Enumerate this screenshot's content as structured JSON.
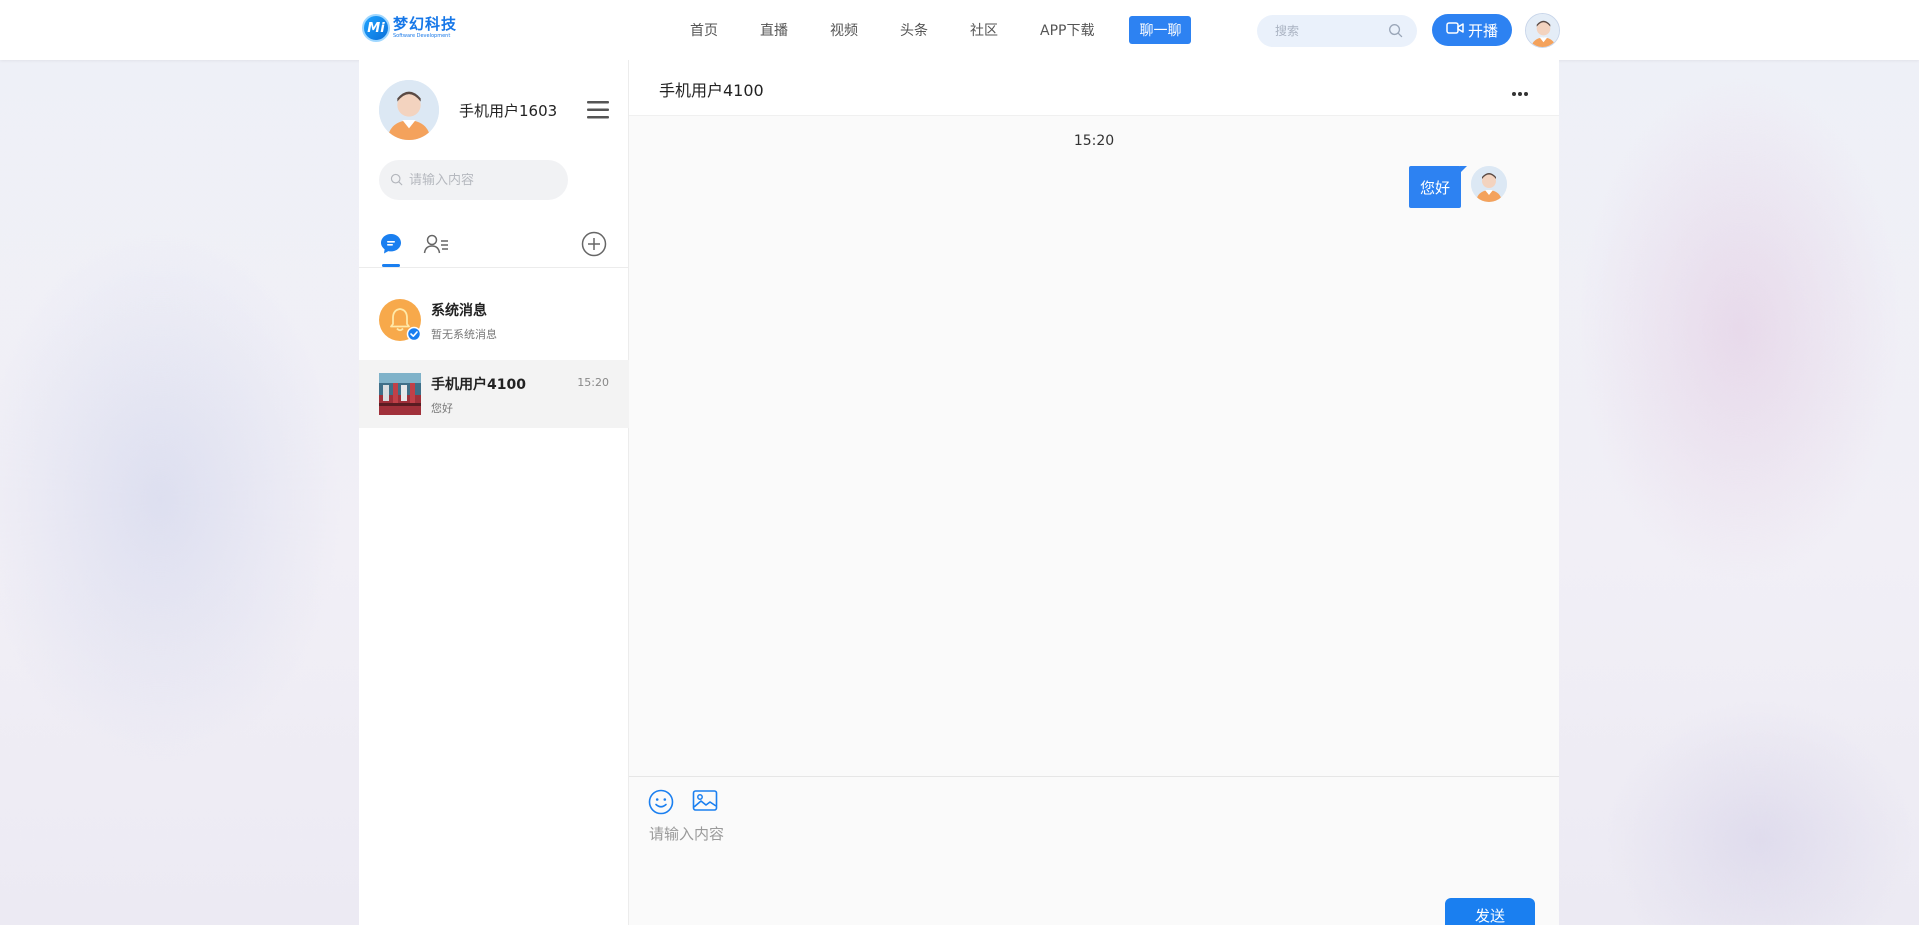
{
  "brand": {
    "name_cn": "梦幻科技",
    "name_en": "Software Development",
    "mark": "Mi"
  },
  "nav": {
    "items": [
      "首页",
      "直播",
      "视频",
      "头条",
      "社区",
      "APP下载"
    ],
    "active": "聊一聊"
  },
  "header_search": {
    "placeholder": "搜索"
  },
  "live_button": {
    "label": "开播"
  },
  "sidebar": {
    "me_name": "手机用户1603",
    "search_placeholder": "请输入内容",
    "conversations": [
      {
        "title": "系统消息",
        "subtitle": "暂无系统消息",
        "time": ""
      },
      {
        "title": "手机用户4100",
        "subtitle": "您好",
        "time": "15:20"
      }
    ]
  },
  "chat": {
    "title": "手机用户4100",
    "timestamp": "15:20",
    "messages": [
      {
        "text": "您好",
        "from": "me"
      }
    ],
    "input_placeholder": "请输入内容",
    "send_label": "发送"
  },
  "colors": {
    "accent": "#2d82f2",
    "system_avatar": "#f7a94b"
  },
  "icons": [
    "search-icon",
    "camera-icon",
    "menu-icon",
    "chat-bubble-icon",
    "contacts-icon",
    "add-circle-icon",
    "bell-icon",
    "verified-check-icon",
    "more-icon",
    "emoji-icon",
    "image-icon"
  ]
}
